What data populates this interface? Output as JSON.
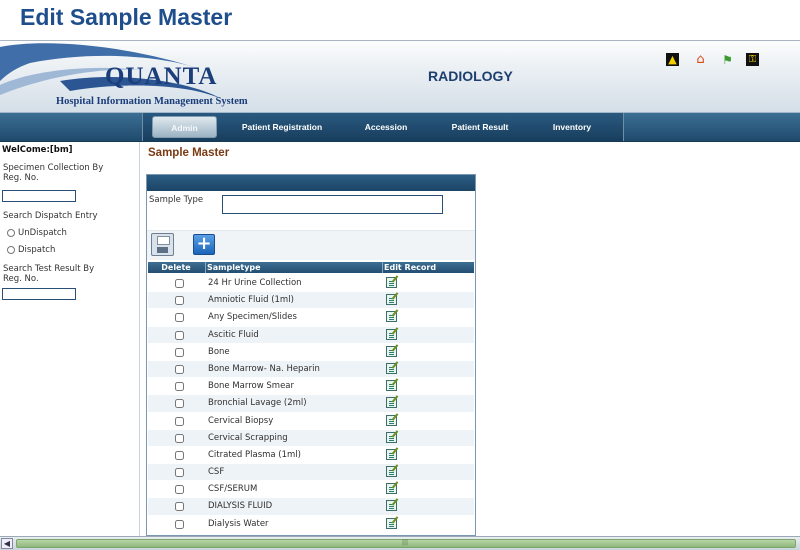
{
  "slide_title": "Edit Sample Master",
  "header": {
    "logo_word": "QUANTA",
    "logo_tagline": "Hospital Information Management System",
    "module": "RADIOLOGY",
    "icons": [
      "up-arrow-icon",
      "home-icon",
      "flag-icon",
      "key-icon"
    ]
  },
  "nav": {
    "tabs": [
      {
        "label": "Admin",
        "active": true
      },
      {
        "label": "Patient Registration"
      },
      {
        "label": "Accession"
      },
      {
        "label": "Patient Result"
      },
      {
        "label": "Inventory"
      }
    ]
  },
  "sidebar": {
    "welcome": "WelCome:[bm]",
    "specimen_label": "Specimen Collection By Reg. No.",
    "specimen_value": "",
    "dispatch_label": "Search Dispatch Entry",
    "radio_undispatch": "UnDispatch",
    "radio_dispatch": "Dispatch",
    "test_result_label": "Search Test Result By Reg. No.",
    "test_result_value": ""
  },
  "main": {
    "heading": "Sample Master",
    "sample_type_label": "Sample Type",
    "sample_type_value": "",
    "grid": {
      "headers": [
        "Delete",
        "Sampletype",
        "Edit Record"
      ],
      "rows": [
        "24 Hr Urine Collection",
        "Amniotic Fluid (1ml)",
        "Any Specimen/Slides",
        "Ascitic Fluid",
        "Bone",
        "Bone Marrow- Na. Heparin",
        "Bone Marrow Smear",
        "Bronchial Lavage (2ml)",
        "Cervical Biopsy",
        "Cervical Scrapping",
        "Citrated Plasma (1ml)",
        "CSF",
        "CSF/SERUM",
        "DIALYSIS FLUID",
        "Dialysis Water"
      ]
    }
  },
  "colors": {
    "title": "#1f4e8c",
    "nav": "#1f4a6c",
    "heading": "#7a3a13"
  }
}
